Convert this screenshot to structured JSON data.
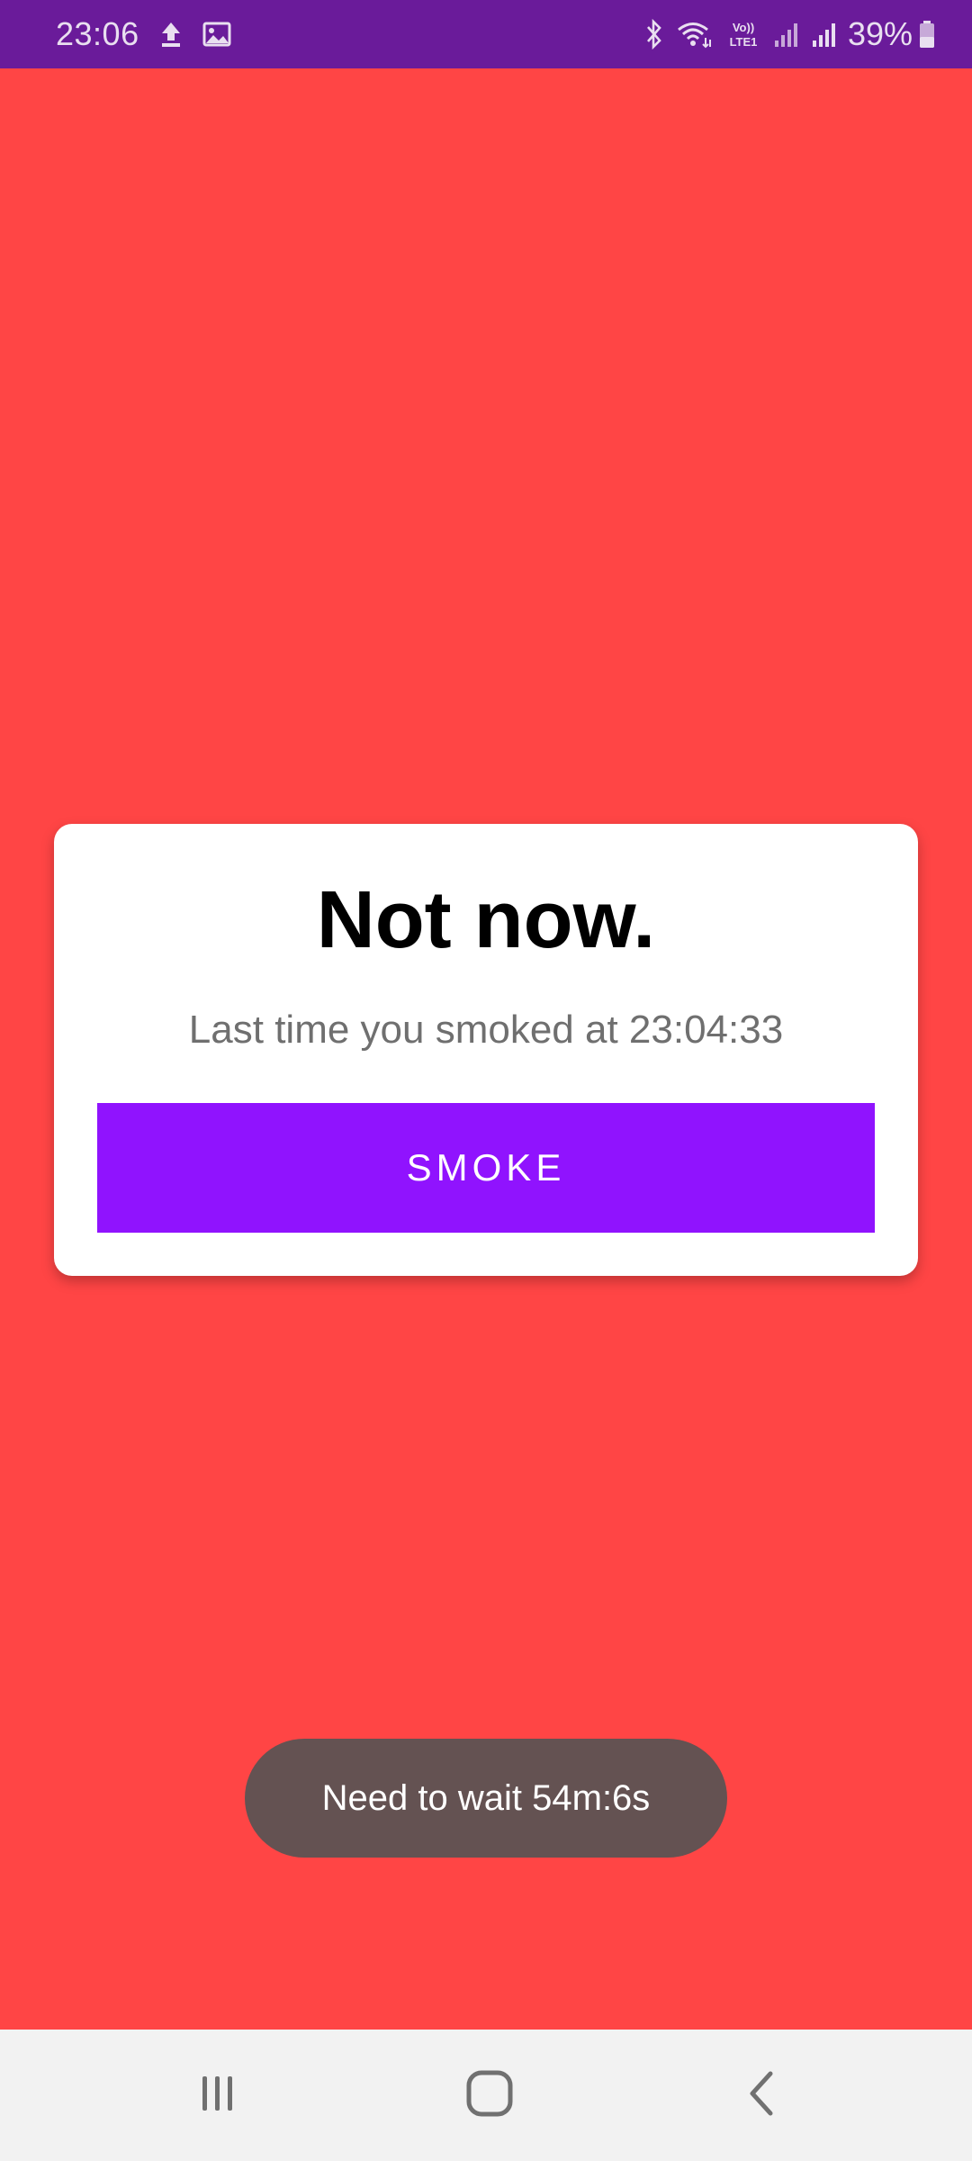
{
  "status_bar": {
    "time": "23:06",
    "battery_text": "39%",
    "icons_left": [
      "upload-icon",
      "gallery-icon"
    ],
    "icons_right": [
      "bluetooth-icon",
      "wifi-icon",
      "volte-icon",
      "signal-icon",
      "signal-icon",
      "battery-icon"
    ],
    "volte_label_top": "Vo))",
    "volte_label_bottom": "LTE1",
    "background_color": "#6a1b9a"
  },
  "app": {
    "background_color": "#ff4545"
  },
  "card": {
    "title": "Not now.",
    "subtitle": "Last time you smoked at 23:04:33",
    "button_label": "SMOKE",
    "button_color": "#9013fe"
  },
  "toast": {
    "message": "Need to wait 54m:6s",
    "background_color": "#645252"
  },
  "nav_bar": {
    "buttons": [
      "recent-apps-icon",
      "home-icon",
      "back-icon"
    ]
  }
}
